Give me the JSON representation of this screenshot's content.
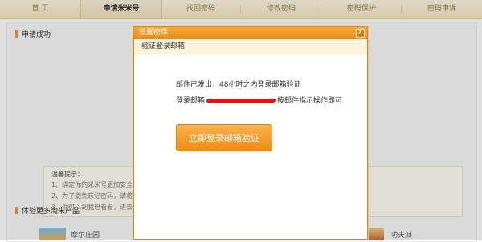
{
  "nav": {
    "tabs": [
      {
        "label": "首 页",
        "active": false
      },
      {
        "label": "申请米米号",
        "active": true
      },
      {
        "label": "找回密码",
        "active": false
      },
      {
        "label": "修改密码",
        "active": false
      },
      {
        "label": "密码保护",
        "active": false
      },
      {
        "label": "密码申诉",
        "active": false
      }
    ]
  },
  "page": {
    "section_title": "申请成功",
    "tips": {
      "title": "温馨提示：",
      "items": [
        "1、绑定你的米米号更加安全，帮我",
        "2、为了避免忘记密码，请将 米号",
        "3、你可以到我巴看看，进去看看"
      ]
    },
    "products_title": "体验更多淘米产品",
    "products": [
      "摩尔庄园",
      "功夫派"
    ]
  },
  "dialog": {
    "title": "设置密保",
    "close_label": "X",
    "subtitle": "验证登录邮箱",
    "message_line1": "邮件已发出，48小时之内登录邮箱验证",
    "email_label": "登录邮箱",
    "email_suffix": "按邮件指示操作即可",
    "button_label": "立即登录邮箱验证"
  },
  "colors": {
    "accent": "#f29b2b",
    "title_bar": "#ec8a12",
    "redaction": "#e81010"
  }
}
